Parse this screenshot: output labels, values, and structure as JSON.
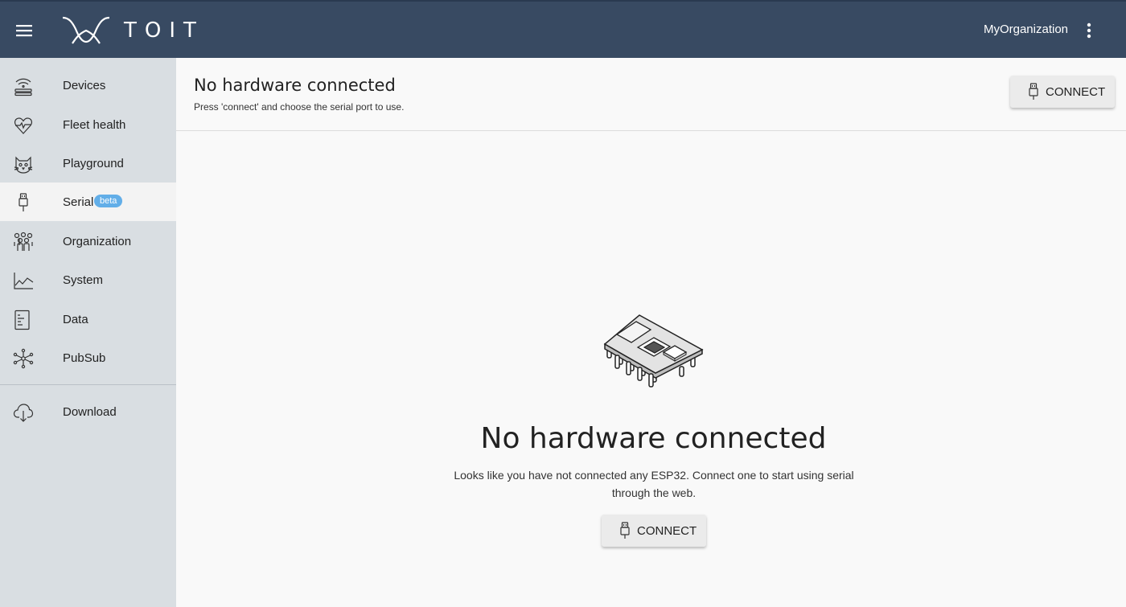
{
  "topbar": {
    "logo_text": "TOIT",
    "org_name": "MyOrganization",
    "menu_icon": "hamburger-menu-icon",
    "more_icon": "more-vertical-icon"
  },
  "sidebar": {
    "items": [
      {
        "label": "Devices",
        "icon": "devices-icon"
      },
      {
        "label": "Fleet health",
        "icon": "heart-icon"
      },
      {
        "label": "Playground",
        "icon": "cat-icon"
      },
      {
        "label": "Serial",
        "icon": "usb-icon",
        "badge": "beta",
        "active": true
      },
      {
        "label": "Organization",
        "icon": "people-icon"
      },
      {
        "label": "System",
        "icon": "chart-icon"
      },
      {
        "label": "Data",
        "icon": "document-icon"
      },
      {
        "label": "PubSub",
        "icon": "network-icon"
      },
      {
        "label": "Download",
        "icon": "cloud-download-icon"
      }
    ]
  },
  "main": {
    "header_title": "No hardware connected",
    "header_subtitle": "Press 'connect' and choose the serial port to use.",
    "connect_label": "CONNECT",
    "empty_title": "No hardware connected",
    "empty_description": "Looks like you have not connected any ESP32. Connect one to start using serial through the web.",
    "empty_connect_label": "CONNECT"
  },
  "colors": {
    "topbar": "#384a62",
    "sidebar": "#d9dee2",
    "badge": "#62aee8"
  }
}
